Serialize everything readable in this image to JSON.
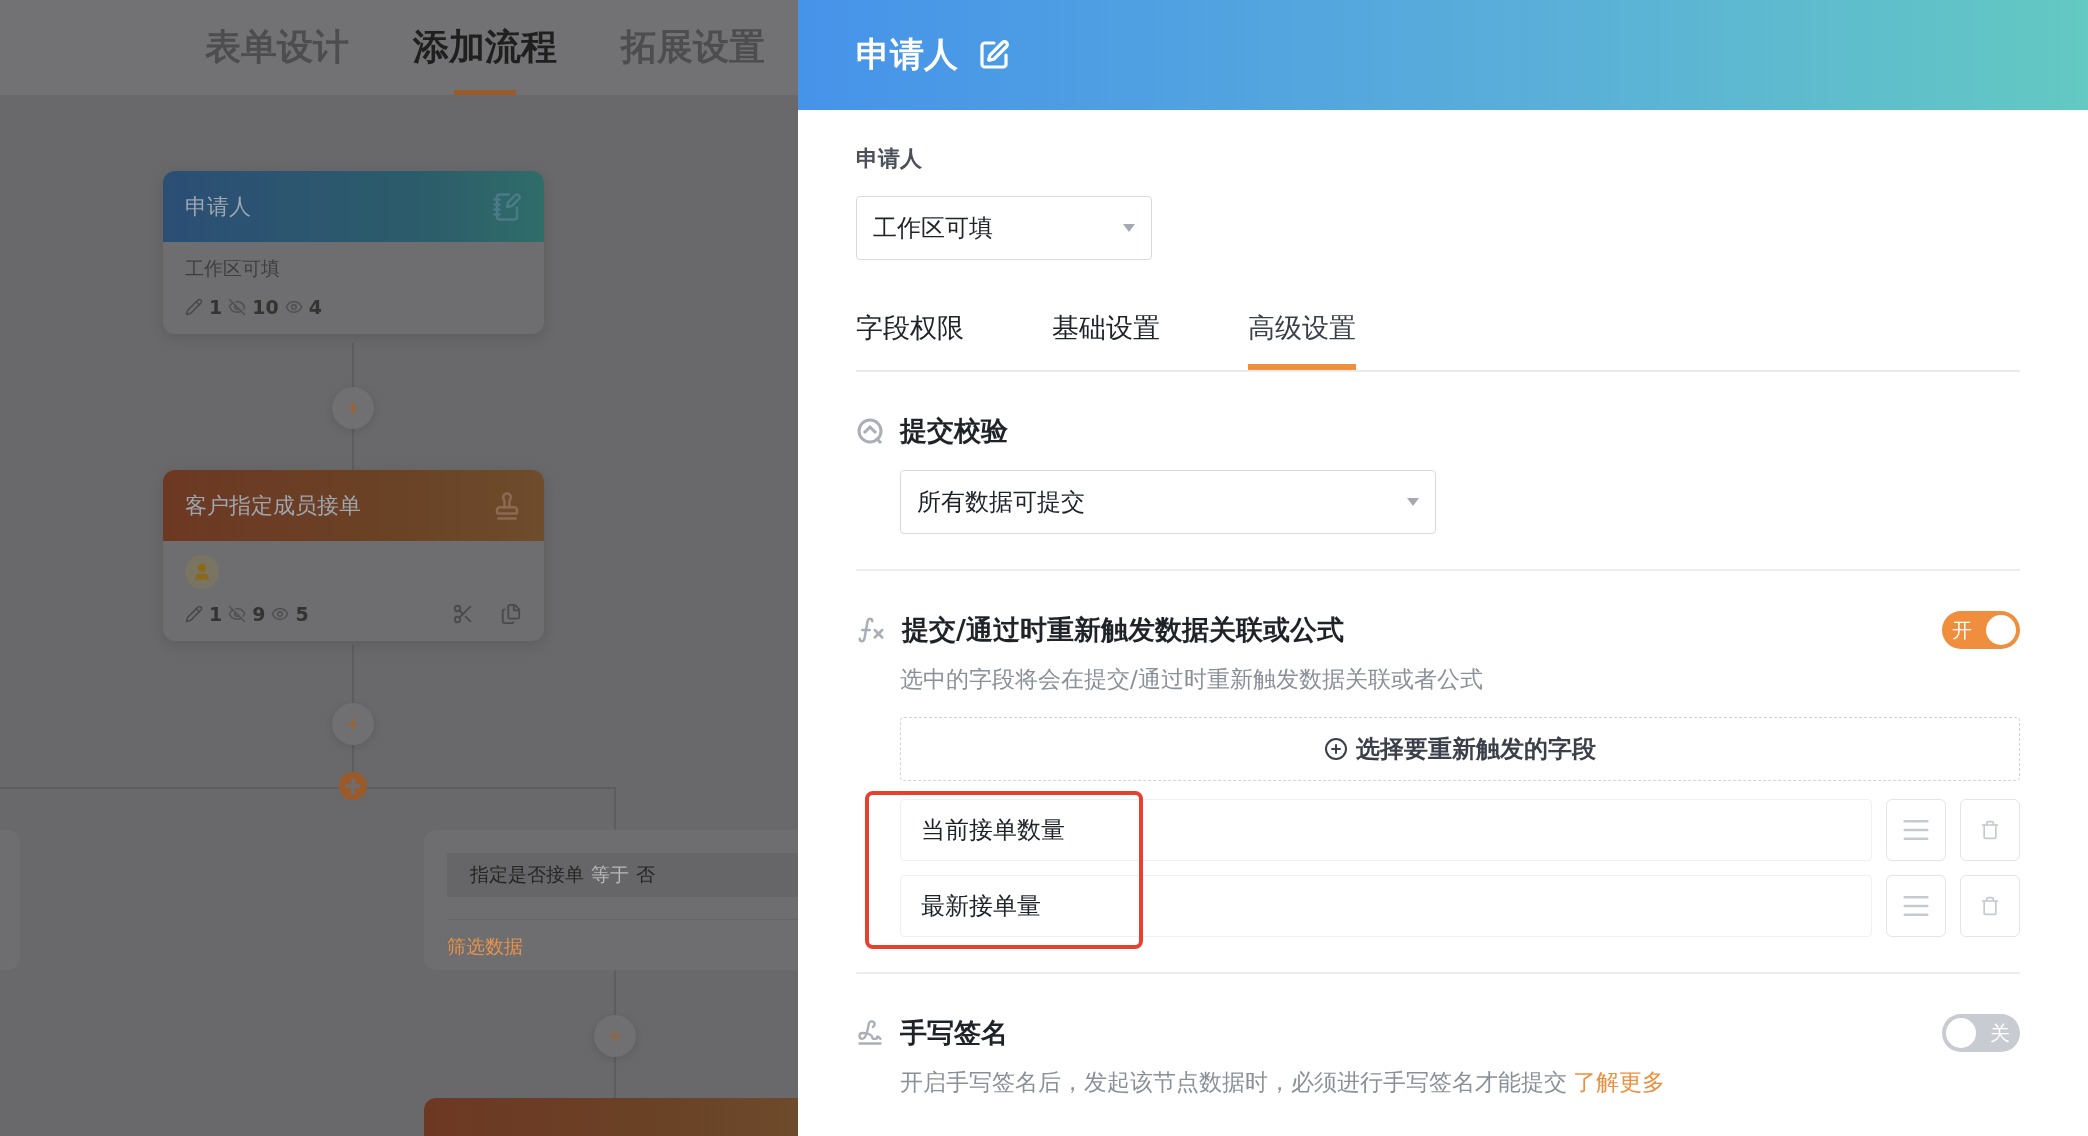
{
  "flow_tabs": [
    {
      "label": "表单设计",
      "selected": false
    },
    {
      "label": "添加流程",
      "selected": true
    },
    {
      "label": "拓展设置",
      "selected": false
    }
  ],
  "flow_nodes": [
    {
      "kind": "applicant",
      "title": "申请人",
      "subtitle": "工作区可填",
      "stats": [
        "1",
        "10",
        "4"
      ]
    },
    {
      "kind": "approver",
      "title": "客户指定成员接单",
      "stats": [
        "1",
        "9",
        "5"
      ]
    }
  ],
  "branch": {
    "field": "指定是否接单",
    "operator": "等于",
    "value": "否",
    "link": "筛选数据"
  },
  "panel": {
    "title": "申请人",
    "field_label": "申请人",
    "field_select": "工作区可填",
    "tabs": [
      {
        "label": "字段权限",
        "selected": false
      },
      {
        "label": "基础设置",
        "selected": false
      },
      {
        "label": "高级设置",
        "selected": true
      }
    ],
    "sections": [
      {
        "kind": "select",
        "title": "提交校验",
        "select": "所有数据可提交"
      },
      {
        "kind": "fields",
        "title": "提交/通过时重新触发数据关联或公式",
        "on": true,
        "toggle_label": "开",
        "description": "选中的字段将会在提交/通过时重新触发数据关联或者公式",
        "add_button": "选择要重新触发的字段",
        "fields": [
          "当前接单数量",
          "最新接单量"
        ],
        "highlighted": true
      },
      {
        "kind": "toggle",
        "title": "手写签名",
        "on": false,
        "toggle_label": "关",
        "description": "开启手写签名后，发起该节点数据时，必须进行手写签名才能提交",
        "link": "了解更多"
      }
    ]
  }
}
